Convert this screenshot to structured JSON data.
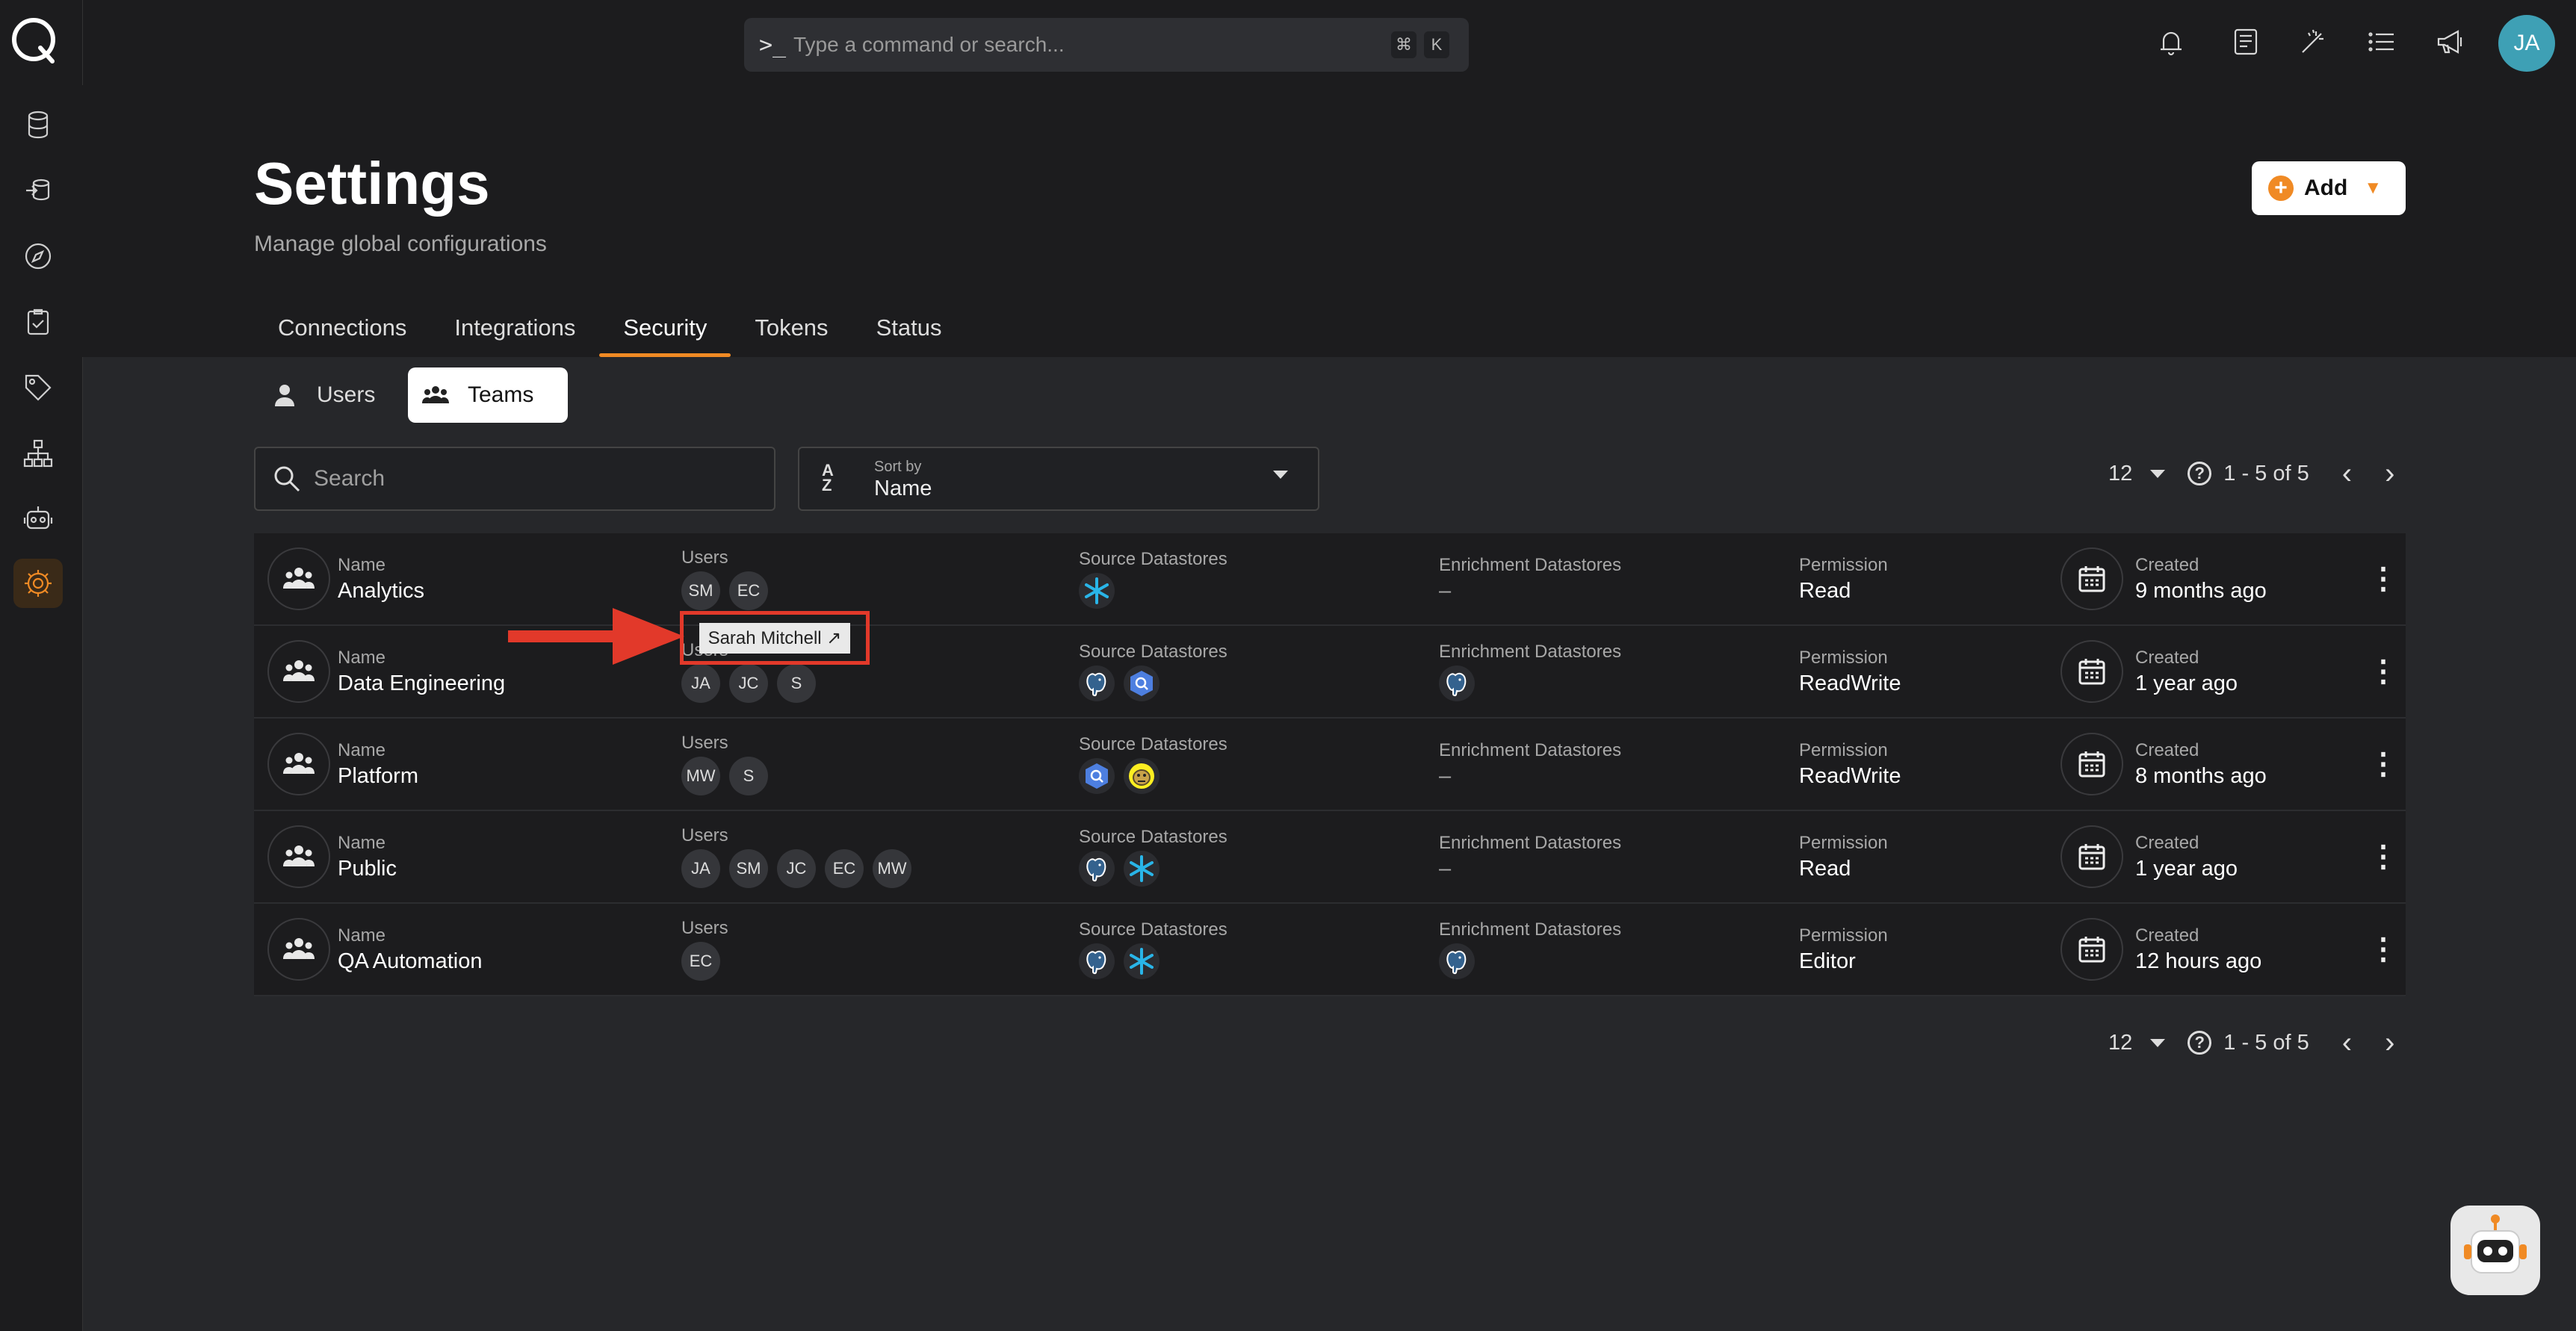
{
  "command_bar": {
    "prompt": ">_",
    "placeholder": "Type a command or search...",
    "key1": "⌘",
    "key2": "K"
  },
  "user": {
    "initials": "JA"
  },
  "header": {
    "title": "Settings",
    "subtitle": "Manage global configurations",
    "add_label": "Add"
  },
  "tabs": [
    {
      "label": "Connections"
    },
    {
      "label": "Integrations"
    },
    {
      "label": "Security",
      "active": true
    },
    {
      "label": "Tokens"
    },
    {
      "label": "Status"
    }
  ],
  "segments": {
    "users": "Users",
    "teams": "Teams"
  },
  "search": {
    "placeholder": "Search"
  },
  "sort": {
    "label": "Sort by",
    "value": "Name",
    "icon_top": "A",
    "icon_bottom": "Z"
  },
  "pager": {
    "page_size": "12",
    "help": "?",
    "range": "1 - 5 of 5"
  },
  "columns": {
    "name": "Name",
    "users": "Users",
    "source": "Source Datastores",
    "enrichment": "Enrichment Datastores",
    "permission": "Permission",
    "created": "Created"
  },
  "rows": [
    {
      "name": "Analytics",
      "users": [
        "SM",
        "EC"
      ],
      "source": [
        "snowflake"
      ],
      "enrichment": [],
      "enrichment_empty": "–",
      "permission": "Read",
      "created": "9 months ago"
    },
    {
      "name": "Data Engineering",
      "users": [
        "JA",
        "JC",
        "S"
      ],
      "source": [
        "postgres",
        "bigquery"
      ],
      "enrichment": [
        "postgres"
      ],
      "enrichment_empty": "",
      "permission": "ReadWrite",
      "created": "1 year ago"
    },
    {
      "name": "Platform",
      "users": [
        "MW",
        "S"
      ],
      "source": [
        "bigquery",
        "hive"
      ],
      "enrichment": [],
      "enrichment_empty": "–",
      "permission": "ReadWrite",
      "created": "8 months ago"
    },
    {
      "name": "Public",
      "users": [
        "JA",
        "SM",
        "JC",
        "EC",
        "MW"
      ],
      "source": [
        "postgres",
        "snowflake"
      ],
      "enrichment": [],
      "enrichment_empty": "–",
      "permission": "Read",
      "created": "1 year ago"
    },
    {
      "name": "QA Automation",
      "users": [
        "EC"
      ],
      "source": [
        "postgres",
        "snowflake"
      ],
      "enrichment": [
        "postgres"
      ],
      "enrichment_empty": "",
      "permission": "Editor",
      "created": "12 hours ago"
    }
  ],
  "tooltip": {
    "text": "Sarah Mitchell ↗"
  },
  "colors": {
    "accent": "#f08a24",
    "annotation": "#e2392a",
    "avatar": "#3ea0b5"
  }
}
